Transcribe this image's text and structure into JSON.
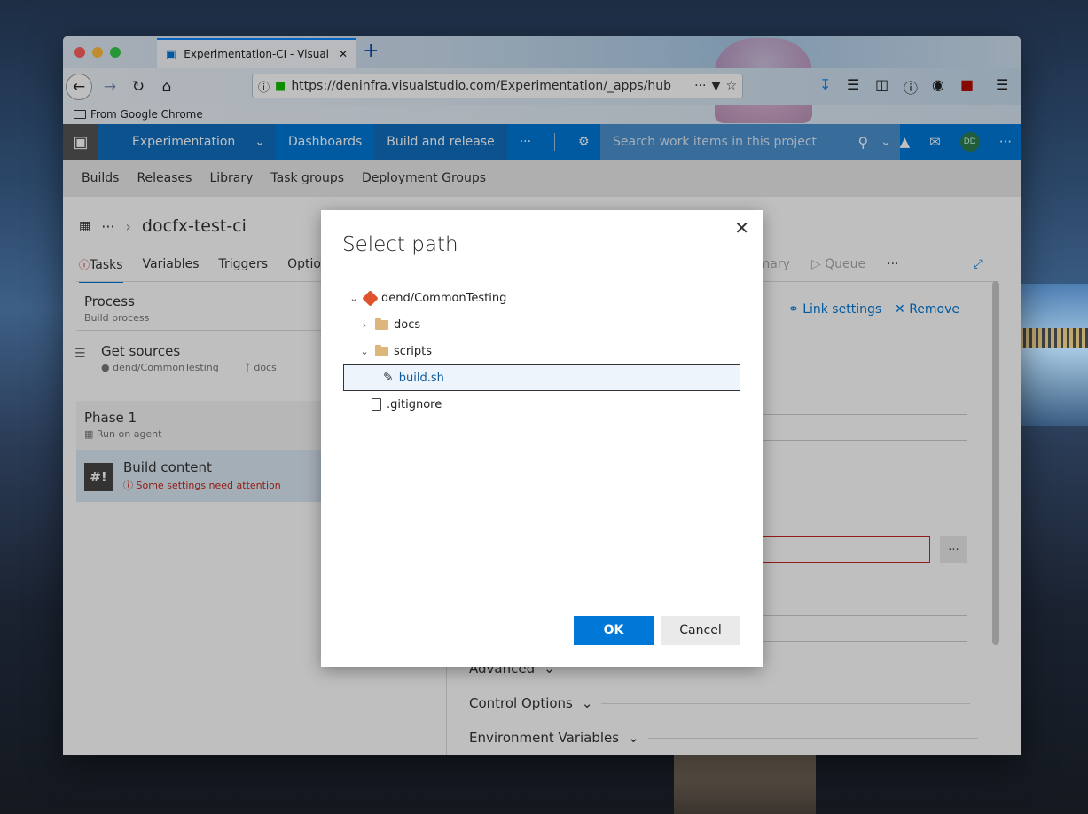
{
  "browser": {
    "tab_title": "Experimentation-CI - Visual Stu",
    "url": "https://deninfra.visualstudio.com/Experimentation/_apps/hub",
    "bookmark": "From Google Chrome"
  },
  "vsts": {
    "project": "Experimentation",
    "nav": [
      "Dashboards",
      "Build and release"
    ],
    "more": "···",
    "search_placeholder": "Search work items in this project",
    "avatar": "DD"
  },
  "subnav": [
    "Builds",
    "Releases",
    "Library",
    "Task groups",
    "Deployment Groups"
  ],
  "page": {
    "breadcrumb_more": "···",
    "title": "docfx-test-ci",
    "tabs": [
      "Tasks",
      "Variables",
      "Triggers",
      "Option"
    ],
    "right_actions": [
      "mmary",
      "Queue",
      "···"
    ],
    "process_title": "Process",
    "process_sub": "Build process",
    "get_sources_title": "Get sources",
    "get_sources_repo": "dend/CommonTesting",
    "get_sources_branch": "docs",
    "phase_title": "Phase 1",
    "phase_sub": "Run on agent",
    "task_title": "Build content",
    "task_warning": "Some settings need attention",
    "link_settings": "Link settings",
    "remove": "Remove",
    "field_more": "···",
    "sections": [
      "Advanced",
      "Control Options",
      "Environment Variables"
    ]
  },
  "dialog": {
    "title": "Select path",
    "tree": [
      {
        "label": "dend/CommonTesting",
        "type": "repo",
        "depth": 0,
        "expanded": true
      },
      {
        "label": "docs",
        "type": "folder",
        "depth": 1,
        "expanded": false
      },
      {
        "label": "scripts",
        "type": "folder",
        "depth": 1,
        "expanded": true
      },
      {
        "label": "build.sh",
        "type": "script",
        "depth": 2,
        "selected": true
      },
      {
        "label": ".gitignore",
        "type": "file",
        "depth": 1
      }
    ],
    "ok": "OK",
    "cancel": "Cancel"
  },
  "colors": {
    "accent": "#0078d7",
    "error": "#c4281c"
  }
}
